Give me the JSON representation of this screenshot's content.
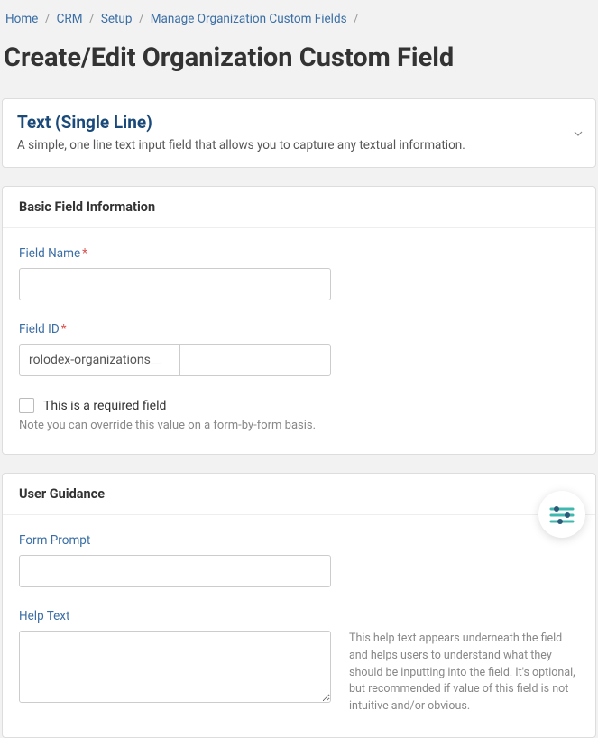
{
  "breadcrumb": {
    "home": "Home",
    "crm": "CRM",
    "setup": "Setup",
    "manage": "Manage Organization Custom Fields"
  },
  "page_title": "Create/Edit Organization Custom Field",
  "field_type": {
    "title": "Text (Single Line)",
    "description": "A simple, one line text input field that allows you to capture any textual information."
  },
  "section_basic": {
    "heading": "Basic Field Information",
    "field_name_label": "Field Name",
    "field_name_value": "",
    "field_id_label": "Field ID",
    "field_id_prefix": "rolodex-organizations__",
    "field_id_value": "",
    "required_label": "This is a required field",
    "required_note": "Note you can override this value on a form-by-form basis."
  },
  "section_guidance": {
    "heading": "User Guidance",
    "form_prompt_label": "Form Prompt",
    "form_prompt_value": "",
    "help_text_label": "Help Text",
    "help_text_value": "",
    "help_text_side": "This help text appears underneath the field and helps users to understand what they should be inputting into the field. It's optional, but recommended if value of this field is not intuitive and/or obvious."
  }
}
